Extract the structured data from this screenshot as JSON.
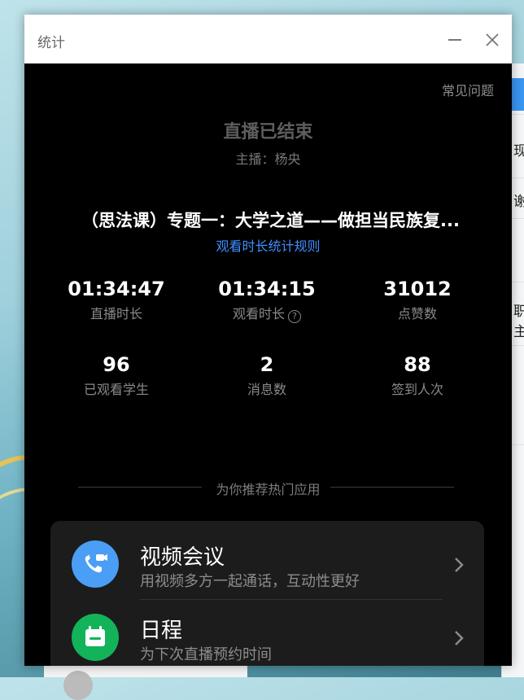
{
  "window": {
    "title": "统计"
  },
  "header": {
    "faq_label": "常见问题",
    "status": "直播已结束",
    "host": "主播：杨央",
    "course_title": "（思法课）专题一：大学之道——做担当民族复...",
    "rules_link": "观看时长统计规则"
  },
  "stats": [
    {
      "value": "01:34:47",
      "label": "直播时长"
    },
    {
      "value": "01:34:15",
      "label": "观看时长"
    },
    {
      "value": "31012",
      "label": "点赞数"
    },
    {
      "value": "96",
      "label": "已观看学生"
    },
    {
      "value": "2",
      "label": "消息数"
    },
    {
      "value": "88",
      "label": "签到人次"
    }
  ],
  "recommend": {
    "title": "为你推荐热门应用",
    "apps": [
      {
        "name": "视频会议",
        "desc": "用视频多方一起通话，互动性更好",
        "icon": "video-call-icon",
        "color": "#4a9ef5"
      },
      {
        "name": "日程",
        "desc": "为下次直播预约时间",
        "icon": "calendar-icon",
        "color": "#13b35a"
      }
    ]
  },
  "background": {
    "peek_text": [
      "现",
      "谢",
      "职",
      "主"
    ]
  },
  "icons": [
    "minimize-icon",
    "close-icon",
    "help-circle-icon",
    "chevron-right-icon"
  ]
}
